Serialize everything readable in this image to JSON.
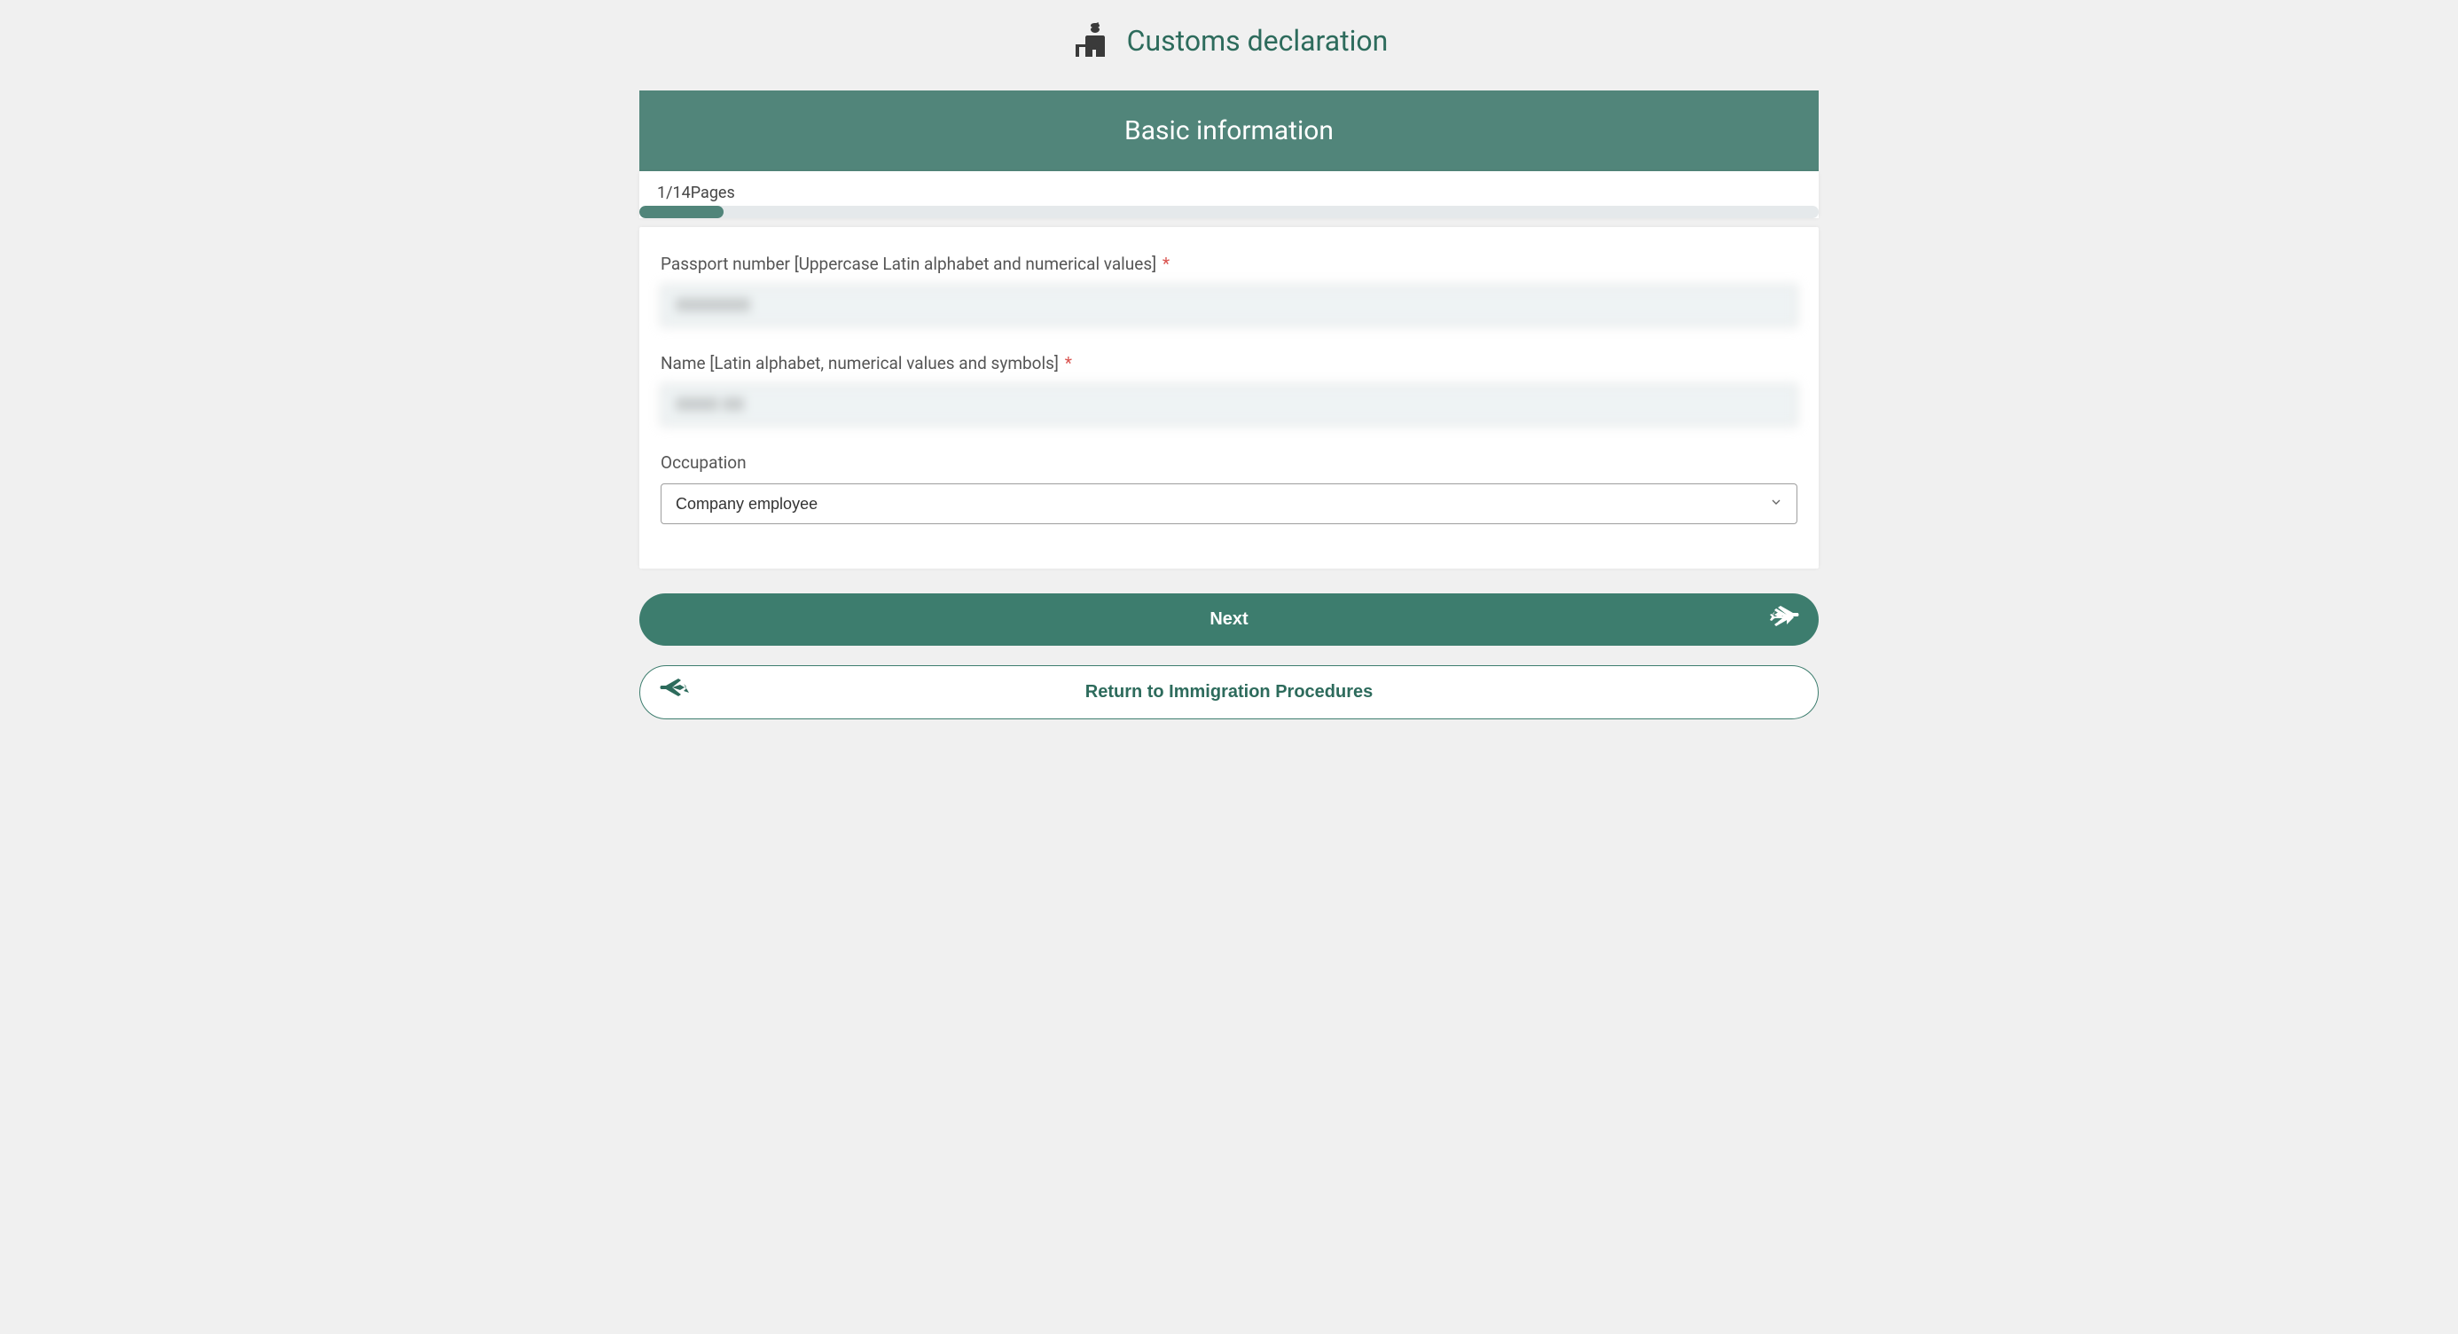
{
  "header": {
    "title": "Customs declaration"
  },
  "section": {
    "title": "Basic information"
  },
  "progress": {
    "label": "1/14Pages",
    "percent": 7.14
  },
  "form": {
    "passport": {
      "label": "Passport number [Uppercase Latin alphabet and numerical values]",
      "required": true,
      "value": "XXXXXXX"
    },
    "name": {
      "label": "Name [Latin alphabet, numerical values and symbols]",
      "required": true,
      "value": "XXXX XX"
    },
    "occupation": {
      "label": "Occupation",
      "required": false,
      "selected": "Company employee"
    }
  },
  "buttons": {
    "next": "Next",
    "return": "Return to Immigration Procedures"
  },
  "colors": {
    "brand": "#3d7d6e",
    "header_text": "#2d6b5c",
    "section_bg": "#51857a",
    "page_bg": "#f0f0f0",
    "required": "#d9534f"
  }
}
